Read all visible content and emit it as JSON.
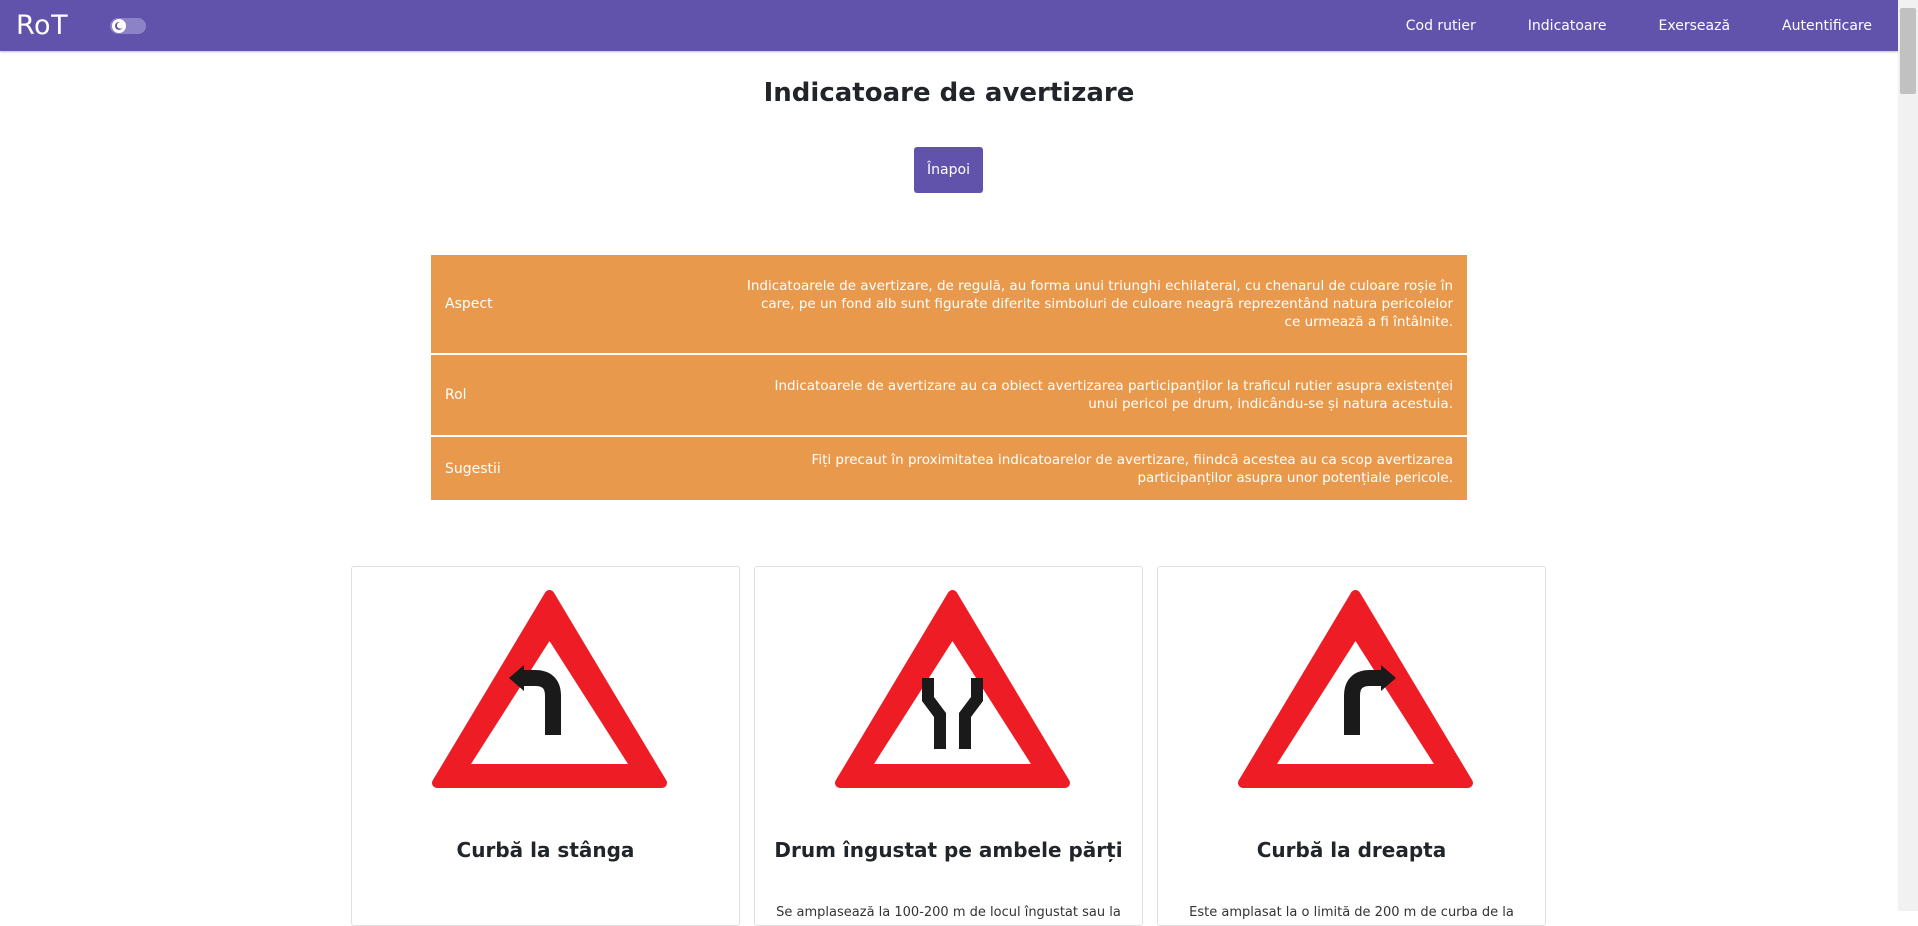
{
  "navbar": {
    "brand": "RoT",
    "links": [
      "Cod rutier",
      "Indicatoare",
      "Exersează",
      "Autentificare"
    ]
  },
  "page": {
    "title": "Indicatoare de avertizare",
    "back_label": "Înapoi"
  },
  "info": [
    {
      "key": "Aspect",
      "value": "Indicatoarele de avertizare, de regulă, au forma unui triunghi echilateral, cu chenarul de culoare roșie în care, pe un fond alb sunt figurate diferite simboluri de culoare neagră reprezentând natura pericolelor ce urmează a fi întâlnite."
    },
    {
      "key": "Rol",
      "value": "Indicatoarele de avertizare au ca obiect avertizarea participanților la traficul rutier asupra existenței unui pericol pe drum, indicându-se și natura acestuia."
    },
    {
      "key": "Sugestii",
      "value": "Fiți precaut în proximitatea indicatoarelor de avertizare, fiindcă acestea au ca scop avertizarea participanților asupra unor potențiale pericole."
    }
  ],
  "cards": [
    {
      "title": "Curbă la stânga",
      "snippet": "",
      "icon": "curve-left-sign"
    },
    {
      "title": "Drum îngustat pe ambele părți",
      "snippet": "Se amplasează la 100-200 m de locul îngustat sau la",
      "icon": "road-narrows-sign"
    },
    {
      "title": "Curbă la dreapta",
      "snippet": "Este amplasat la o limită de 200 m de curba de la",
      "icon": "curve-right-sign"
    }
  ],
  "colors": {
    "navbar": "#6153ac",
    "info_row": "#e9994b",
    "sign_red": "#ee1c25",
    "button": "#6153ac"
  }
}
